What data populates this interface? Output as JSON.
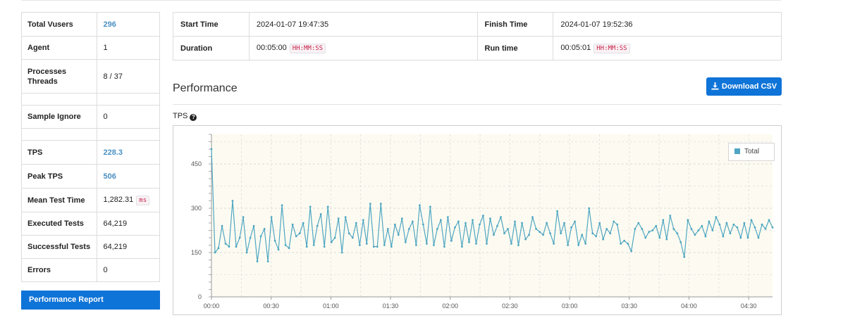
{
  "summary": {
    "total_vusers_label": "Total Vusers",
    "total_vusers": "296",
    "agent_label": "Agent",
    "agent": "1",
    "processes_label": "Processes",
    "threads_label": "Threads",
    "processes_threads": "8 / 37",
    "sample_ignore_label": "Sample Ignore",
    "sample_ignore": "0",
    "tps_label": "TPS",
    "tps": "228.3",
    "peak_tps_label": "Peak TPS",
    "peak_tps": "506",
    "mean_test_time_label": "Mean Test Time",
    "mean_test_time": "1,282.31",
    "mean_test_time_unit": "ms",
    "executed_tests_label": "Executed Tests",
    "executed_tests": "64,219",
    "successful_tests_label": "Successful Tests",
    "successful_tests": "64,219",
    "errors_label": "Errors",
    "errors": "0"
  },
  "perf_report_button": "Performance Report",
  "times": {
    "start_label": "Start Time",
    "start": "2024-01-07 19:47:35",
    "finish_label": "Finish Time",
    "finish": "2024-01-07 19:52:36",
    "duration_label": "Duration",
    "duration": "00:05:00",
    "duration_format": "HH:MM:SS",
    "run_label": "Run time",
    "run": "00:05:01",
    "run_format": "HH:MM:SS"
  },
  "performance_title": "Performance",
  "download_csv": "Download CSV",
  "tps_chart_label": "TPS",
  "colors": {
    "accent": "#0f74d8",
    "series": "#4fa6c2",
    "plot_bg": "#fdfbf1"
  },
  "chart_data": {
    "type": "line",
    "title": "TPS",
    "xlabel": "",
    "ylabel": "",
    "xlim": [
      0,
      282
    ],
    "ylim": [
      0,
      550
    ],
    "y_ticks": [
      0,
      150,
      300,
      450
    ],
    "x_ticks": [
      "00:00",
      "00:30",
      "01:00",
      "01:30",
      "02:00",
      "02:30",
      "03:00",
      "03:30",
      "04:00",
      "04:30"
    ],
    "x_tick_seconds": [
      0,
      30,
      60,
      90,
      120,
      150,
      180,
      210,
      240,
      270
    ],
    "grid": true,
    "legend": "top-right",
    "series": [
      {
        "name": "Total",
        "values": [
          500,
          150,
          165,
          240,
          180,
          170,
          325,
          170,
          200,
          270,
          150,
          200,
          240,
          120,
          205,
          230,
          120,
          270,
          190,
          160,
          310,
          175,
          165,
          245,
          205,
          215,
          250,
          170,
          305,
          175,
          240,
          280,
          170,
          305,
          185,
          200,
          265,
          150,
          270,
          215,
          200,
          250,
          175,
          260,
          180,
          315,
          170,
          170,
          315,
          175,
          230,
          170,
          245,
          210,
          265,
          185,
          230,
          255,
          175,
          310,
          245,
          180,
          305,
          175,
          230,
          260,
          170,
          270,
          190,
          235,
          255,
          170,
          250,
          185,
          260,
          180,
          245,
          275,
          180,
          265,
          210,
          240,
          270,
          215,
          230,
          180,
          255,
          175,
          250,
          195,
          210,
          270,
          230,
          220,
          210,
          250,
          215,
          180,
          290,
          215,
          250,
          175,
          235,
          255,
          175,
          210,
          180,
          300,
          215,
          205,
          250,
          195,
          230,
          215,
          255,
          245,
          180,
          190,
          180,
          155,
          230,
          250,
          230,
          200,
          220,
          225,
          240,
          200,
          260,
          195,
          275,
          230,
          215,
          185,
          135,
          260,
          230,
          210,
          225,
          240,
          205,
          255,
          225,
          270,
          245,
          205,
          250,
          215,
          245,
          235,
          200,
          250,
          200,
          260,
          235,
          200,
          245,
          230,
          260,
          235
        ]
      }
    ]
  }
}
